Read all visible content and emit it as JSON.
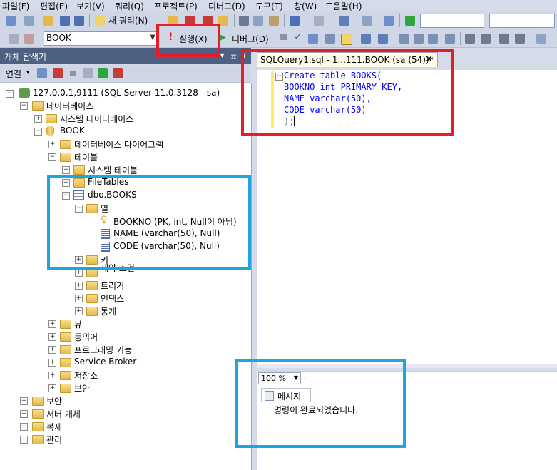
{
  "menu": [
    "파일(F)",
    "편집(E)",
    "보기(V)",
    "쿼리(Q)",
    "프로젝트(P)",
    "디버그(D)",
    "도구(T)",
    "창(W)",
    "도움말(H)"
  ],
  "toolbar": {
    "new_query": "새 쿼리(N)",
    "database": "BOOK",
    "execute": "실행(X)",
    "debug": "디버그(D)"
  },
  "object_explorer": {
    "title": "개체 탐색기",
    "connect": "연결",
    "pin": "ㅍ",
    "close": "x",
    "server": "127.0.0.1,9111 (SQL Server 11.0.3128 - sa)",
    "databases": "데이터베이스",
    "system_databases": "시스템 데이터베이스",
    "book_db": "BOOK",
    "db_diagrams": "데이터베이스 다이어그램",
    "tables": "테이블",
    "system_tables": "시스템 테이블",
    "file_tables": "FileTables",
    "books_table": "dbo.BOOKS",
    "columns": "열",
    "col_bookno": "BOOKNO (PK, int, Null이 아님)",
    "col_name": "NAME (varchar(50), Null)",
    "col_code": "CODE (varchar(50), Null)",
    "keys": "키",
    "constraints": "제약 조건",
    "triggers": "트리거",
    "indexes": "인덱스",
    "statistics": "통계",
    "views": "뷰",
    "synonyms": "동의어",
    "programmability": "프로그래밍 기능",
    "service_broker": "Service Broker",
    "storage": "저장소",
    "db_security": "보안",
    "security": "보안",
    "server_objects": "서버 개체",
    "replication": "복제",
    "management": "관리"
  },
  "editor": {
    "tab_title": "SQLQuery1.sql - 1...111.BOOK (sa (54))*",
    "tab_close": "✕",
    "lines": [
      "Create table BOOKS(",
      "BOOKNO int PRIMARY KEY,",
      "NAME varchar(50),",
      "CODE varchar(50)",
      ");"
    ]
  },
  "zoom_level": "100 %",
  "results": {
    "tab_label": "메시지",
    "message": "명령이 완료되었습니다."
  },
  "colors": {
    "highlight_red": "#e81c24",
    "highlight_blue": "#1ea5e0",
    "keyword_blue": "#0000ff"
  }
}
